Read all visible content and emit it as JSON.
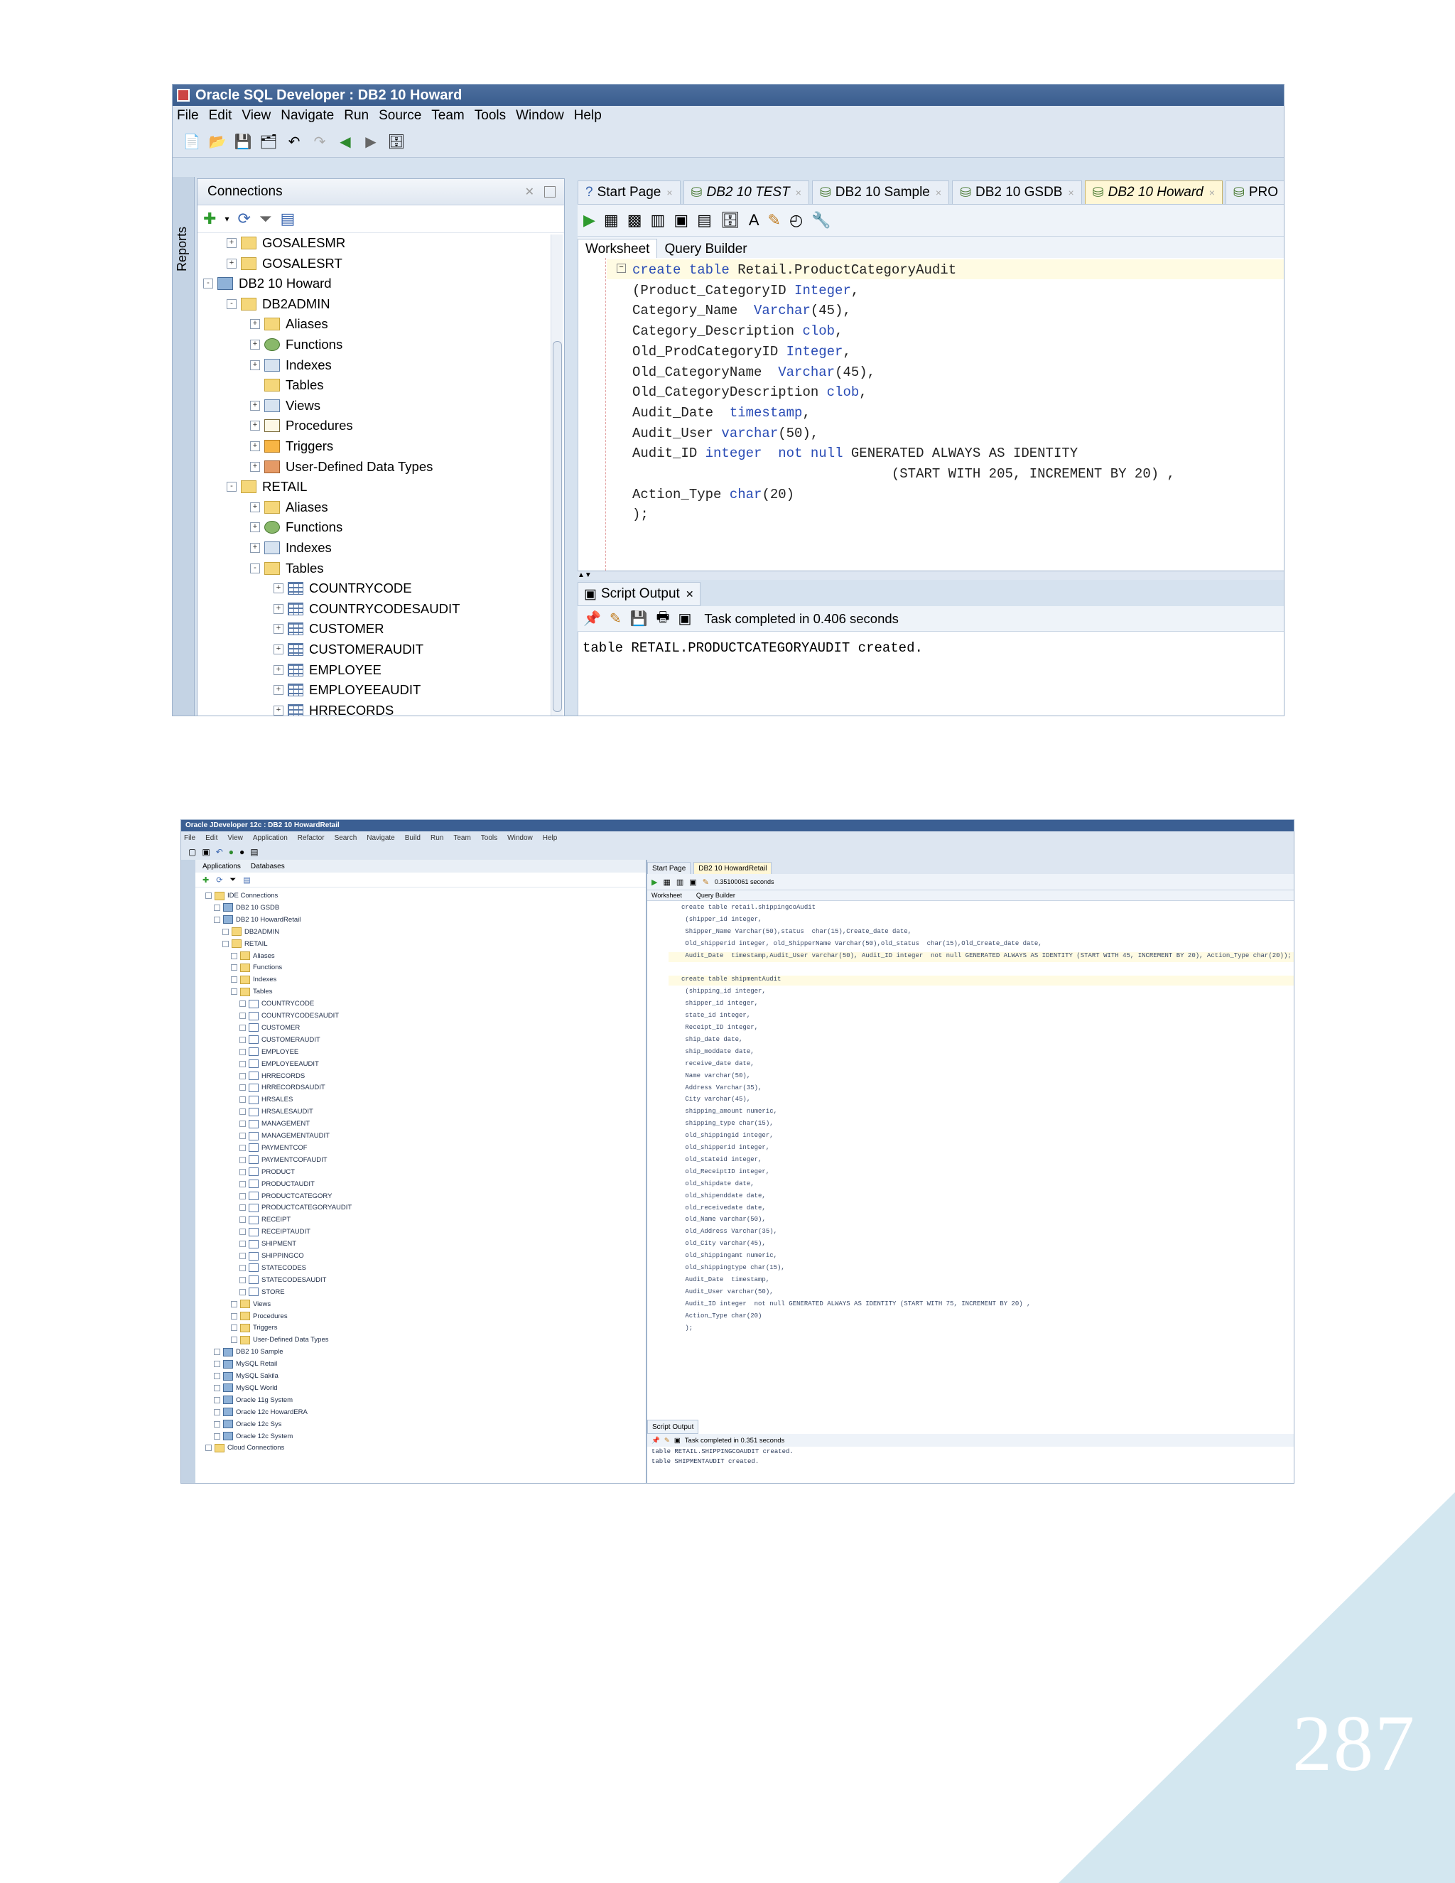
{
  "page_number": "287",
  "screenshot1": {
    "window_title": "Oracle SQL Developer : DB2 10 Howard",
    "menu": [
      "File",
      "Edit",
      "View",
      "Navigate",
      "Run",
      "Source",
      "Team",
      "Tools",
      "Window",
      "Help"
    ],
    "left_rail_label": "Reports",
    "connections_title": "Connections",
    "tree": [
      {
        "label": "GOSALESMR",
        "level": 2,
        "icon": "folder",
        "expand": "+"
      },
      {
        "label": "GOSALESRT",
        "level": 2,
        "icon": "folder",
        "expand": "+"
      },
      {
        "label": "DB2 10 Howard",
        "level": 1,
        "icon": "conn",
        "expand": "-"
      },
      {
        "label": "DB2ADMIN",
        "level": 2,
        "icon": "folder",
        "expand": "-"
      },
      {
        "label": "Aliases",
        "level": 3,
        "icon": "folder",
        "expand": "+"
      },
      {
        "label": "Functions",
        "level": 3,
        "icon": "func",
        "expand": "+"
      },
      {
        "label": "Indexes",
        "level": 3,
        "icon": "view",
        "expand": "+"
      },
      {
        "label": "Tables",
        "level": 3,
        "icon": "folder",
        "expand": ""
      },
      {
        "label": "Views",
        "level": 3,
        "icon": "view",
        "expand": "+"
      },
      {
        "label": "Procedures",
        "level": 3,
        "icon": "proc",
        "expand": "+"
      },
      {
        "label": "Triggers",
        "level": 3,
        "icon": "trig",
        "expand": "+"
      },
      {
        "label": "User-Defined Data Types",
        "level": 3,
        "icon": "udt",
        "expand": "+"
      },
      {
        "label": "RETAIL",
        "level": 2,
        "icon": "folder",
        "expand": "-"
      },
      {
        "label": "Aliases",
        "level": 3,
        "icon": "folder",
        "expand": "+"
      },
      {
        "label": "Functions",
        "level": 3,
        "icon": "func",
        "expand": "+"
      },
      {
        "label": "Indexes",
        "level": 3,
        "icon": "view",
        "expand": "+"
      },
      {
        "label": "Tables",
        "level": 3,
        "icon": "folder",
        "expand": "-"
      },
      {
        "label": "COUNTRYCODE",
        "level": 4,
        "icon": "table",
        "expand": "+"
      },
      {
        "label": "COUNTRYCODESAUDIT",
        "level": 4,
        "icon": "table",
        "expand": "+"
      },
      {
        "label": "CUSTOMER",
        "level": 4,
        "icon": "table",
        "expand": "+"
      },
      {
        "label": "CUSTOMERAUDIT",
        "level": 4,
        "icon": "table",
        "expand": "+"
      },
      {
        "label": "EMPLOYEE",
        "level": 4,
        "icon": "table",
        "expand": "+"
      },
      {
        "label": "EMPLOYEEAUDIT",
        "level": 4,
        "icon": "table",
        "expand": "+"
      },
      {
        "label": "HRRECORDS",
        "level": 4,
        "icon": "table",
        "expand": "+"
      }
    ],
    "doc_tabs": [
      {
        "label": "Start Page",
        "italic": false,
        "active": false
      },
      {
        "label": "DB2 10 TEST",
        "italic": true,
        "active": false
      },
      {
        "label": "DB2 10 Sample",
        "italic": false,
        "active": false
      },
      {
        "label": "DB2 10 GSDB",
        "italic": false,
        "active": false
      },
      {
        "label": "DB2 10 Howard",
        "italic": true,
        "active": true
      },
      {
        "label": "PRO",
        "italic": false,
        "active": false
      }
    ],
    "sub_tabs": [
      "Worksheet",
      "Query Builder"
    ],
    "code_lines": [
      "create table Retail.ProductCategoryAudit",
      "(Product_CategoryID Integer,",
      "Category_Name  Varchar(45),",
      "Category_Description clob,",
      "Old_ProdCategoryID Integer,",
      "Old_CategoryName  Varchar(45),",
      "Old_CategoryDescription clob,",
      "Audit_Date  timestamp,",
      "Audit_User varchar(50),",
      "Audit_ID integer  not null GENERATED ALWAYS AS IDENTITY",
      "                                (START WITH 205, INCREMENT BY 20) ,",
      "Action_Type char(20)",
      ");"
    ],
    "output_tab": "Script Output",
    "output_status": "Task completed in 0.406 seconds",
    "output_lines": [
      "table RETAIL.PRODUCTCATEGORYAUDIT created."
    ]
  },
  "screenshot2": {
    "window_title": "Oracle JDeveloper 12c : DB2 10 HowardRetail",
    "menu": [
      "File",
      "Edit",
      "View",
      "Application",
      "Refactor",
      "Search",
      "Navigate",
      "Build",
      "Run",
      "Team",
      "Tools",
      "Window",
      "Help"
    ],
    "nav_tabs": [
      "Applications",
      "Databases"
    ],
    "tree": [
      {
        "label": "IDE Connections",
        "level": 0
      },
      {
        "label": "DB2 10 GSDB",
        "level": 1
      },
      {
        "label": "DB2 10 HowardRetail",
        "level": 1
      },
      {
        "label": "DB2ADMIN",
        "level": 2
      },
      {
        "label": "RETAIL",
        "level": 2
      },
      {
        "label": "Aliases",
        "level": 3
      },
      {
        "label": "Functions",
        "level": 3
      },
      {
        "label": "Indexes",
        "level": 3
      },
      {
        "label": "Tables",
        "level": 3
      },
      {
        "label": "COUNTRYCODE",
        "level": 4
      },
      {
        "label": "COUNTRYCODESAUDIT",
        "level": 4
      },
      {
        "label": "CUSTOMER",
        "level": 4
      },
      {
        "label": "CUSTOMERAUDIT",
        "level": 4
      },
      {
        "label": "EMPLOYEE",
        "level": 4
      },
      {
        "label": "EMPLOYEEAUDIT",
        "level": 4
      },
      {
        "label": "HRRECORDS",
        "level": 4
      },
      {
        "label": "HRRECORDSAUDIT",
        "level": 4
      },
      {
        "label": "HRSALES",
        "level": 4
      },
      {
        "label": "HRSALESAUDIT",
        "level": 4
      },
      {
        "label": "MANAGEMENT",
        "level": 4
      },
      {
        "label": "MANAGEMENTAUDIT",
        "level": 4
      },
      {
        "label": "PAYMENTCOF",
        "level": 4
      },
      {
        "label": "PAYMENTCOFAUDIT",
        "level": 4
      },
      {
        "label": "PRODUCT",
        "level": 4
      },
      {
        "label": "PRODUCTAUDIT",
        "level": 4
      },
      {
        "label": "PRODUCTCATEGORY",
        "level": 4
      },
      {
        "label": "PRODUCTCATEGORYAUDIT",
        "level": 4
      },
      {
        "label": "RECEIPT",
        "level": 4
      },
      {
        "label": "RECEIPTAUDIT",
        "level": 4
      },
      {
        "label": "SHIPMENT",
        "level": 4
      },
      {
        "label": "SHIPPINGCO",
        "level": 4
      },
      {
        "label": "STATECODES",
        "level": 4
      },
      {
        "label": "STATECODESAUDIT",
        "level": 4
      },
      {
        "label": "STORE",
        "level": 4
      },
      {
        "label": "Views",
        "level": 3
      },
      {
        "label": "Procedures",
        "level": 3
      },
      {
        "label": "Triggers",
        "level": 3
      },
      {
        "label": "User-Defined Data Types",
        "level": 3
      },
      {
        "label": "DB2 10 Sample",
        "level": 1
      },
      {
        "label": "MySQL Retail",
        "level": 1
      },
      {
        "label": "MySQL Sakila",
        "level": 1
      },
      {
        "label": "MySQL World",
        "level": 1
      },
      {
        "label": "Oracle 11g System",
        "level": 1
      },
      {
        "label": "Oracle 12c HowardERA",
        "level": 1
      },
      {
        "label": "Oracle 12c Sys",
        "level": 1
      },
      {
        "label": "Oracle 12c System",
        "level": 1
      },
      {
        "label": "Cloud Connections",
        "level": 0
      }
    ],
    "doc_tabs": [
      "Start Page",
      "DB2 10 HowardRetail"
    ],
    "exec_time": "0.35100061 seconds",
    "sub_tabs": [
      "Worksheet",
      "Query Builder"
    ],
    "code_lines": [
      "create table retail.shippingcoAudit",
      " (shipper_id integer,",
      " Shipper_Name Varchar(50),status  char(15),Create_date date,",
      " Old_shipperid integer, old_ShipperName Varchar(50),old_status  char(15),Old_Create_date date,",
      " Audit_Date  timestamp,Audit_User varchar(50), Audit_ID integer  not null GENERATED ALWAYS AS IDENTITY (START WITH 45, INCREMENT BY 20), Action_Type char(20));",
      "",
      "create table shipmentAudit",
      " (shipping_id integer,",
      " shipper_id integer,",
      " state_id integer,",
      " Receipt_ID integer,",
      " ship_date date,",
      " ship_moddate date,",
      " receive_date date,",
      " Name varchar(50),",
      " Address Varchar(35),",
      " City varchar(45),",
      " shipping_amount numeric,",
      " shipping_type char(15),",
      " old_shippingid integer,",
      " old_shipperid integer,",
      " old_stateid integer,",
      " old_ReceiptID integer,",
      " old_shipdate date,",
      " old_shipenddate date,",
      " old_receivedate date,",
      " old_Name varchar(50),",
      " old_Address Varchar(35),",
      " old_City varchar(45),",
      " old_shippingamt numeric,",
      " old_shippingtype char(15),",
      " Audit_Date  timestamp,",
      " Audit_User varchar(50),",
      " Audit_ID integer  not null GENERATED ALWAYS AS IDENTITY (START WITH 75, INCREMENT BY 20) ,",
      " Action_Type char(20)",
      " );"
    ],
    "output_tab": "Script Output",
    "output_status": "Task completed in 0.351 seconds",
    "output_lines": [
      "table RETAIL.SHIPPINGCOAUDIT created.",
      "table SHIPMENTAUDIT created."
    ]
  }
}
